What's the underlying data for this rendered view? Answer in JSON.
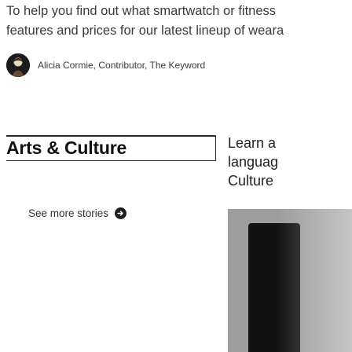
{
  "article": {
    "dek_line1": "To help you find out what smartwatch or fitness",
    "dek_line2": "features and prices for our latest lineup of weara",
    "byline": "Alicia Cormie, Contributor, The Keyword"
  },
  "section": {
    "heading": "Arts & Culture",
    "see_more": "See more stories"
  },
  "story_card": {
    "title_line1": "Learn a",
    "title_line2": "languag",
    "title_line3": "Culture"
  }
}
